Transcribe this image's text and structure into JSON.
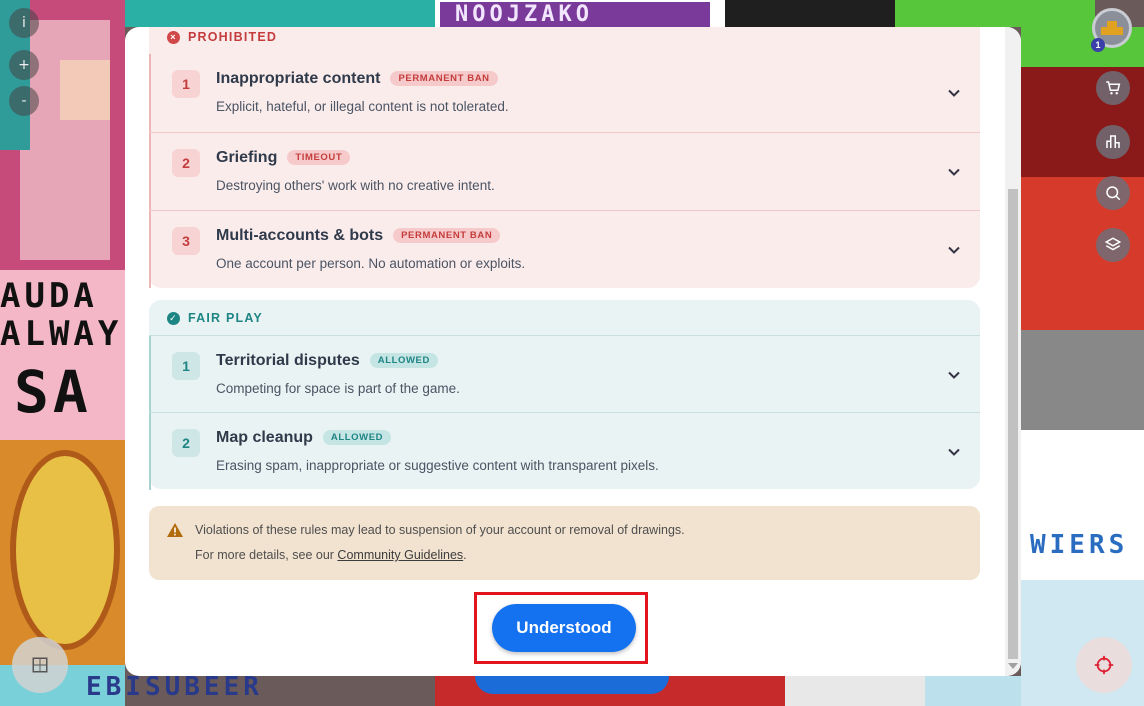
{
  "window_controls": {
    "info_label": "i",
    "zoom_in_label": "+",
    "zoom_out_label": "-"
  },
  "avatar": {
    "badge_count": "1"
  },
  "right_tools": [
    {
      "name": "shop",
      "icon": "cart-icon"
    },
    {
      "name": "leaderboard",
      "icon": "bar-chart-icon"
    },
    {
      "name": "search-color",
      "icon": "palette-search-icon"
    },
    {
      "name": "layers",
      "icon": "layers-icon"
    }
  ],
  "background_text": {
    "line1": "AUDA",
    "line2": "ALWAY",
    "line3": "SA",
    "top": "NOOJZAKO",
    "bottom": "EBISUBEER",
    "right": "WIERS"
  },
  "modal": {
    "prohibited": {
      "header": "PROHIBITED",
      "color_accent": "#c43c3c",
      "rules": [
        {
          "num": "1",
          "title": "Inappropriate content",
          "tag": "PERMANENT BAN",
          "desc": "Explicit, hateful, or illegal content is not tolerated."
        },
        {
          "num": "2",
          "title": "Griefing",
          "tag": "TIMEOUT",
          "desc": "Destroying others' work with no creative intent."
        },
        {
          "num": "3",
          "title": "Multi-accounts & bots",
          "tag": "PERMANENT BAN",
          "desc": "One account per person. No automation or exploits."
        }
      ]
    },
    "fair_play": {
      "header": "FAIR PLAY",
      "color_accent": "#1e8585",
      "rules": [
        {
          "num": "1",
          "title": "Territorial disputes",
          "tag": "ALLOWED",
          "desc": "Competing for space is part of the game."
        },
        {
          "num": "2",
          "title": "Map cleanup",
          "tag": "ALLOWED",
          "desc": "Erasing spam, inappropriate or suggestive content with transparent pixels."
        }
      ]
    },
    "warning": {
      "line1": "Violations of these rules may lead to suspension of your account or removal of drawings.",
      "line2_prefix": "For more details, see our ",
      "link_text": "Community Guidelines",
      "line2_suffix": "."
    },
    "confirm_label": "Understood"
  }
}
